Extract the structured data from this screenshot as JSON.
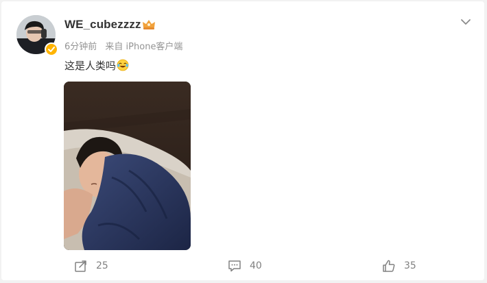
{
  "post": {
    "username": "WE_cubezzzz",
    "time": "6分钟前",
    "source": "来自 iPhone客户端",
    "text": "这是人类吗",
    "emoji_icon": "laughing-tears-emoji"
  },
  "actions": {
    "repost_count": "25",
    "comment_count": "40",
    "like_count": "35"
  },
  "colors": {
    "verified": "#ffb400",
    "muted": "#939393",
    "text": "#333333",
    "background": "#f2f2f2"
  }
}
